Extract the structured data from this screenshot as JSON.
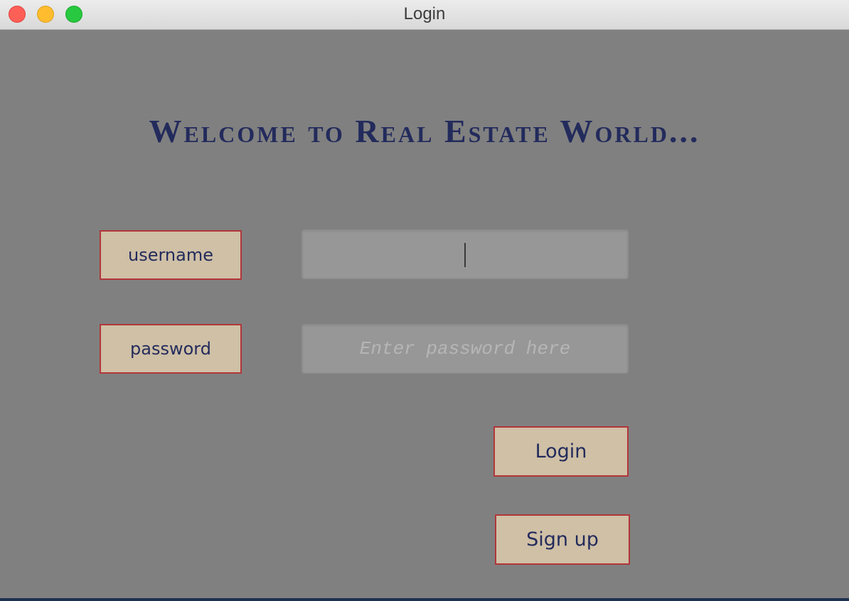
{
  "window": {
    "title": "Login",
    "controls": [
      "close",
      "minimize",
      "zoom"
    ]
  },
  "header": {
    "welcome_text": "Welcome to Real Estate World..."
  },
  "form": {
    "username_label": "username",
    "username_value": "",
    "password_label": "password",
    "password_placeholder": "Enter password here",
    "password_value": ""
  },
  "actions": {
    "login_label": "Login",
    "signup_label": "Sign up"
  },
  "colors": {
    "window_background": "#808080",
    "heading_text": "#232b5c",
    "label_background": "#cfc0a6",
    "label_border": "#b2363a",
    "field_background": "#979797"
  }
}
